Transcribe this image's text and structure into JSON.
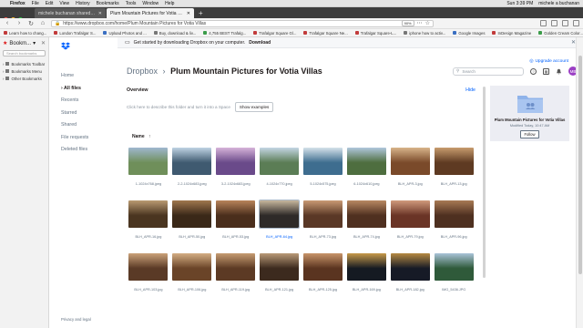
{
  "macos_menubar": {
    "apple": "",
    "app": "Firefox",
    "menus": [
      "File",
      "Edit",
      "View",
      "History",
      "Bookmarks",
      "Tools",
      "Window",
      "Help"
    ],
    "clock": "Sun 3:39 PM",
    "user": "michele a buchanan"
  },
  "browser": {
    "tabs": [
      {
        "title": "michele buchanan shared \"Plum..."
      },
      {
        "title": "Plum Mountain Pictures for Votia Villas"
      }
    ],
    "new_tab": "+",
    "url": "https://www.dropbox.com/home/Plum Mountain Pictures for Votia Villas",
    "zoom": "90%",
    "bookmarks": [
      {
        "label": "Learn how to chang...",
        "color": "#c23b3b"
      },
      {
        "label": "London Trafalgar S...",
        "color": "#c23b3b"
      },
      {
        "label": "Upload Photos and ...",
        "color": "#3b6fc2"
      },
      {
        "label": "Buy, download & liv...",
        "color": "#777777"
      },
      {
        "label": "4,755 BEST Trafalg...",
        "color": "#3b9c4a"
      },
      {
        "label": "Trafalgar Square Gl...",
        "color": "#c23b3b"
      },
      {
        "label": "Trafalgar Square Ne...",
        "color": "#c23b3b"
      },
      {
        "label": "Trafalgar Square-L...",
        "color": "#c23b3b"
      },
      {
        "label": "iphone how to activ...",
        "color": "#777777"
      },
      {
        "label": "Google Images",
        "color": "#3b6fc2"
      },
      {
        "label": "InDesign Magazine",
        "color": "#c23b3b"
      },
      {
        "label": "Golden Cream Color...",
        "color": "#3b9c4a"
      }
    ],
    "other_bookmarks": "Other Bookmarks"
  },
  "bookmarks_sidebar": {
    "title": "Bookm...",
    "search_placeholder": "Search bookmarks",
    "items": [
      "Bookmarks Toolbar",
      "Bookmarks Menu",
      "Other Bookmarks"
    ]
  },
  "dropbox_nav": {
    "items": [
      "Home",
      "All files",
      "Recents",
      "Starred",
      "Shared",
      "File requests",
      "Deleted files"
    ],
    "active_index": 1,
    "privacy": "Privacy and legal"
  },
  "banner": {
    "text": "Get started by downloading Dropbox on your computer.",
    "link": "Download"
  },
  "upgrade": "Upgrade account",
  "header": {
    "root": "Dropbox",
    "separator": "›",
    "folder": "Plum Mountain Pictures for Votia Villas",
    "search_placeholder": "Search",
    "avatar_initials": "MB"
  },
  "overview": {
    "label": "Overview",
    "hide": "Hide",
    "describe_text": "Click here to describe this folder and turn it into a Space",
    "show_examples": "Show examples"
  },
  "list": {
    "sort_label": "Name",
    "sort_arrow": "↑"
  },
  "files": [
    {
      "name": "1-1024x768.jpeg",
      "c1": "#6f8f5a",
      "c2": "#9fb7cf"
    },
    {
      "name": "2-2-1024x683.jpeg",
      "c1": "#3f5a70",
      "c2": "#bfd3e3"
    },
    {
      "name": "3-2-1024x683.jpeg",
      "c1": "#6a4a8a",
      "c2": "#d6b3d9"
    },
    {
      "name": "4-1024x770.jpeg",
      "c1": "#5b7d55",
      "c2": "#c4d6e4"
    },
    {
      "name": "5-1024x575.jpeg",
      "c1": "#3e6d8f",
      "c2": "#d5e2ea"
    },
    {
      "name": "6-1024x610.jpeg",
      "c1": "#4e6e3f",
      "c2": "#b0c7dc"
    },
    {
      "name": "BLH_APR-3.jpg",
      "c1": "#7a4a2a",
      "c2": "#d8b48a"
    },
    {
      "name": "BLH_APR-13.jpg",
      "c1": "#5e3a22",
      "c2": "#c79c6e"
    },
    {
      "name": "BLH_APR-16.jpg",
      "c1": "#4a3520",
      "c2": "#b99a72"
    },
    {
      "name": "BLH_APR-50.jpg",
      "c1": "#3a2818",
      "c2": "#a0784e"
    },
    {
      "name": "BLH_APR-53.jpg",
      "c1": "#4a2e1c",
      "c2": "#b8845a"
    },
    {
      "name": "BLH_APR-64.jpg",
      "c1": "#2e2a28",
      "c2": "#c7b79d"
    },
    {
      "name": "BLH_APR-73.jpg",
      "c1": "#5a3826",
      "c2": "#c99a74"
    },
    {
      "name": "BLH_APR-74.jpg",
      "c1": "#4f3020",
      "c2": "#b88962"
    },
    {
      "name": "BLH_APR-79.jpg",
      "c1": "#6a3426",
      "c2": "#d09a7c"
    },
    {
      "name": "BLH_APR-96.jpg",
      "c1": "#4e3020",
      "c2": "#a87a54"
    },
    {
      "name": "BLH_APR-103.jpg",
      "c1": "#5a3a26",
      "c2": "#cba27a"
    },
    {
      "name": "BLH_APR-106.jpg",
      "c1": "#6a4428",
      "c2": "#d4ae84"
    },
    {
      "name": "BLH_APR-119.jpg",
      "c1": "#5c3a24",
      "c2": "#c69c72"
    },
    {
      "name": "BLH_APR-121.jpg",
      "c1": "#3c2a1e",
      "c2": "#b99a78"
    },
    {
      "name": "BLH_APR-125.jpg",
      "c1": "#5a3420",
      "c2": "#c8956a"
    },
    {
      "name": "BLH_APR-169.jpg",
      "c1": "#151a22",
      "c2": "#c79a4a"
    },
    {
      "name": "BLH_APR-182.jpg",
      "c1": "#161a26",
      "c2": "#b68a42"
    },
    {
      "name": "IMG_5436.JPG",
      "c1": "#2f5a3a",
      "c2": "#a9c3d8"
    }
  ],
  "selected_file_index": 11,
  "info_card": {
    "title": "Plum Mountain Pictures for Votia Villas",
    "modified": "Modified Today, 10:47 AM",
    "follow": "Follow",
    "folder_color": "#8fb3ea"
  },
  "colors": {
    "accent": "#0061fe",
    "avatar": "#9b3fc4"
  }
}
